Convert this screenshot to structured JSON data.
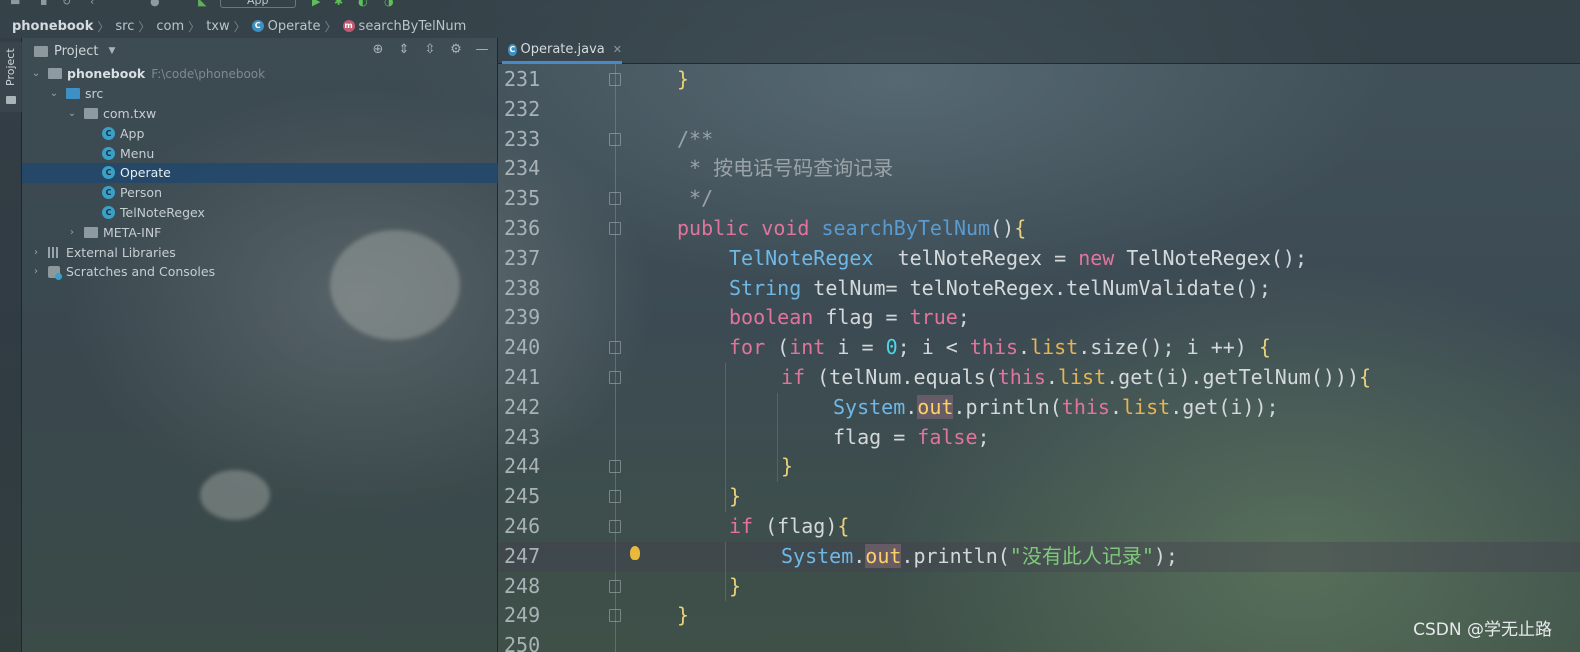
{
  "toolbar": {
    "run_config": "App"
  },
  "breadcrumb": [
    {
      "label": "phonebook",
      "icon": ""
    },
    {
      "label": "src",
      "icon": ""
    },
    {
      "label": "com",
      "icon": ""
    },
    {
      "label": "txw",
      "icon": ""
    },
    {
      "label": "Operate",
      "icon": "class-icon"
    },
    {
      "label": "searchByTelNum",
      "icon": "method-icon"
    }
  ],
  "left_stripe": {
    "tab_label": "Project"
  },
  "project_panel": {
    "title": "Project",
    "tree": [
      {
        "label": "phonebook",
        "path": "F:\\code\\phonebook",
        "depth": 0,
        "expanded": true,
        "type": "project"
      },
      {
        "label": "src",
        "depth": 1,
        "expanded": true,
        "type": "src"
      },
      {
        "label": "com.txw",
        "depth": 2,
        "expanded": true,
        "type": "package"
      },
      {
        "label": "App",
        "depth": 3,
        "type": "class"
      },
      {
        "label": "Menu",
        "depth": 3,
        "type": "class"
      },
      {
        "label": "Operate",
        "depth": 3,
        "type": "class",
        "selected": true
      },
      {
        "label": "Person",
        "depth": 3,
        "type": "class"
      },
      {
        "label": "TelNoteRegex",
        "depth": 3,
        "type": "class"
      },
      {
        "label": "META-INF",
        "depth": 2,
        "expanded": false,
        "type": "folder"
      },
      {
        "label": "External Libraries",
        "depth": 0,
        "expanded": false,
        "type": "libs"
      },
      {
        "label": "Scratches and Consoles",
        "depth": 0,
        "expanded": false,
        "type": "scratches"
      }
    ]
  },
  "editor": {
    "tab_label": "Operate.java",
    "lines": [
      {
        "n": "231",
        "indent": 1,
        "tokens": [
          [
            "br",
            "}"
          ]
        ],
        "fold": true
      },
      {
        "n": "232",
        "indent": 0,
        "tokens": []
      },
      {
        "n": "233",
        "indent": 1,
        "tokens": [
          [
            "cm",
            "/**"
          ]
        ],
        "fold": true
      },
      {
        "n": "234",
        "indent": 1,
        "tokens": [
          [
            "cm",
            " * 按电话号码查询记录"
          ]
        ]
      },
      {
        "n": "235",
        "indent": 1,
        "tokens": [
          [
            "cm",
            " */"
          ]
        ],
        "fold": true
      },
      {
        "n": "236",
        "indent": 1,
        "tokens": [
          [
            "k",
            "public "
          ],
          [
            "k",
            "void "
          ],
          [
            "fn",
            "searchByTelNum"
          ],
          [
            "",
            "()"
          ],
          [
            "br",
            "{"
          ]
        ],
        "fold": true
      },
      {
        "n": "237",
        "indent": 2,
        "tokens": [
          [
            "t",
            "TelNoteRegex "
          ],
          [
            "",
            " telNoteRegex = "
          ],
          [
            "k",
            "new "
          ],
          [
            "",
            "TelNoteRegex();"
          ]
        ]
      },
      {
        "n": "238",
        "indent": 2,
        "tokens": [
          [
            "t",
            "String "
          ],
          [
            "",
            "telNum= telNoteRegex.telNumValidate();"
          ]
        ]
      },
      {
        "n": "239",
        "indent": 2,
        "tokens": [
          [
            "k",
            "boolean "
          ],
          [
            "",
            "flag = "
          ],
          [
            "k",
            "true"
          ],
          [
            "",
            ";"
          ]
        ]
      },
      {
        "n": "240",
        "indent": 2,
        "tokens": [
          [
            "k",
            "for "
          ],
          [
            "",
            "("
          ],
          [
            "k",
            "int "
          ],
          [
            "",
            "i = "
          ],
          [
            "nu",
            "0"
          ],
          [
            "",
            "; i < "
          ],
          [
            "k",
            "this"
          ],
          [
            "",
            "."
          ],
          [
            "fld",
            "list"
          ],
          [
            "",
            ".size(); i ++) "
          ],
          [
            "br",
            "{"
          ]
        ],
        "fold": true
      },
      {
        "n": "241",
        "indent": 3,
        "tokens": [
          [
            "k",
            "if "
          ],
          [
            "",
            "(telNum.equals("
          ],
          [
            "k",
            "this"
          ],
          [
            "",
            "."
          ],
          [
            "fld",
            "list"
          ],
          [
            "",
            ".get(i).getTelNum()))"
          ],
          [
            "br",
            "{"
          ]
        ],
        "fold": true
      },
      {
        "n": "242",
        "indent": 4,
        "tokens": [
          [
            "t",
            "System"
          ],
          [
            "",
            "."
          ],
          [
            "fldhl",
            "out"
          ],
          [
            "",
            ".println("
          ],
          [
            "k",
            "this"
          ],
          [
            "",
            "."
          ],
          [
            "fld",
            "list"
          ],
          [
            "",
            ".get(i));"
          ]
        ]
      },
      {
        "n": "243",
        "indent": 4,
        "tokens": [
          [
            "",
            "flag = "
          ],
          [
            "k",
            "false"
          ],
          [
            "",
            ";"
          ]
        ]
      },
      {
        "n": "244",
        "indent": 3,
        "tokens": [
          [
            "br",
            "}"
          ]
        ],
        "fold": true
      },
      {
        "n": "245",
        "indent": 2,
        "tokens": [
          [
            "br",
            "}"
          ]
        ],
        "fold": true
      },
      {
        "n": "246",
        "indent": 2,
        "tokens": [
          [
            "k",
            "if "
          ],
          [
            "",
            "(flag)"
          ],
          [
            "br",
            "{"
          ]
        ],
        "fold": true
      },
      {
        "n": "247",
        "indent": 3,
        "tokens": [
          [
            "t",
            "System"
          ],
          [
            "",
            "."
          ],
          [
            "fldhl",
            "out"
          ],
          [
            "",
            ".println("
          ],
          [
            "st",
            "\"没有此人记录\""
          ],
          [
            "",
            ");"
          ]
        ],
        "current": true,
        "bulb": true
      },
      {
        "n": "248",
        "indent": 2,
        "tokens": [
          [
            "br",
            "}"
          ]
        ],
        "fold": true
      },
      {
        "n": "249",
        "indent": 1,
        "tokens": [
          [
            "br",
            "}"
          ]
        ],
        "fold": true
      },
      {
        "n": "250",
        "indent": 0,
        "tokens": []
      }
    ]
  },
  "watermark": "CSDN @学无止路"
}
